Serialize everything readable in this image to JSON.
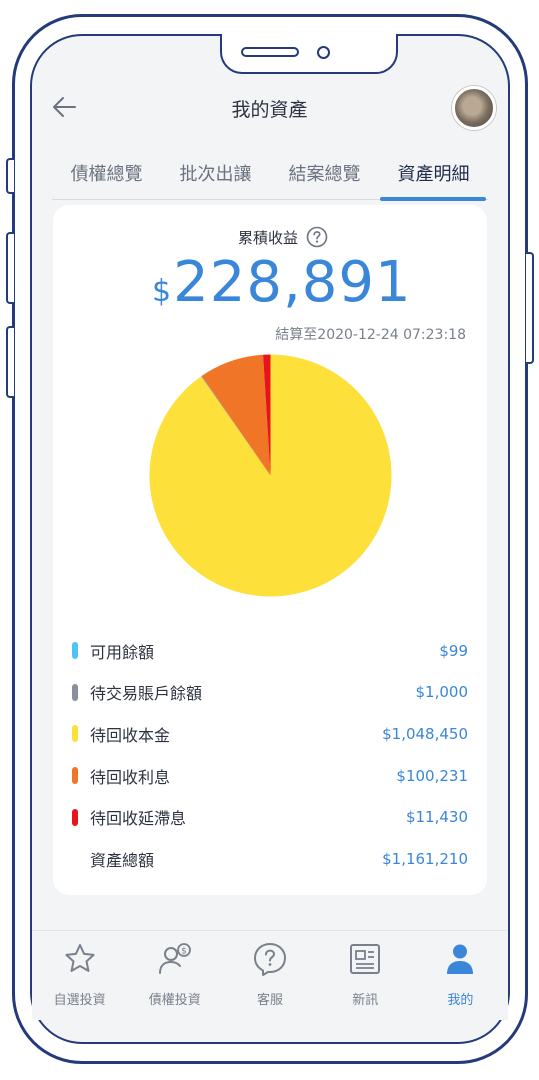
{
  "header": {
    "title": "我的資產"
  },
  "tabs": [
    {
      "label": "債權總覽"
    },
    {
      "label": "批次出讓"
    },
    {
      "label": "結案總覽"
    },
    {
      "label": "資產明細"
    }
  ],
  "summary": {
    "earn_label": "累積收益",
    "currency": "$",
    "amount": "228,891",
    "settle_text": "結算至2020-12-24 07:23:18"
  },
  "chart_data": {
    "type": "pie",
    "slices": [
      {
        "label": "可用餘額",
        "value": 99,
        "color": "#4fc3f7"
      },
      {
        "label": "待交易賬戶餘額",
        "value": 1000,
        "color": "#8a9099"
      },
      {
        "label": "待回收本金",
        "value": 1048450,
        "color": "#fde03a"
      },
      {
        "label": "待回收利息",
        "value": 100231,
        "color": "#f07526"
      },
      {
        "label": "待回收延滯息",
        "value": 11430,
        "color": "#e8141c"
      }
    ]
  },
  "legend": [
    {
      "label": "可用餘額",
      "value": "$99",
      "color": "#4fc3f7"
    },
    {
      "label": "待交易賬戶餘額",
      "value": "$1,000",
      "color": "#8a9099"
    },
    {
      "label": "待回收本金",
      "value": "$1,048,450",
      "color": "#fde03a"
    },
    {
      "label": "待回收利息",
      "value": "$100,231",
      "color": "#f07526"
    },
    {
      "label": "待回收延滯息",
      "value": "$11,430",
      "color": "#e8141c"
    },
    {
      "label": "資產總額",
      "value": "$1,161,210",
      "color": ""
    }
  ],
  "nav": [
    {
      "label": "自選投資",
      "icon": "star-icon"
    },
    {
      "label": "債權投資",
      "icon": "investor-icon"
    },
    {
      "label": "客服",
      "icon": "support-icon"
    },
    {
      "label": "新訊",
      "icon": "news-icon"
    },
    {
      "label": "我的",
      "icon": "profile-icon"
    }
  ],
  "colors": {
    "accent": "#3a86d8",
    "frame": "#243a7a"
  }
}
